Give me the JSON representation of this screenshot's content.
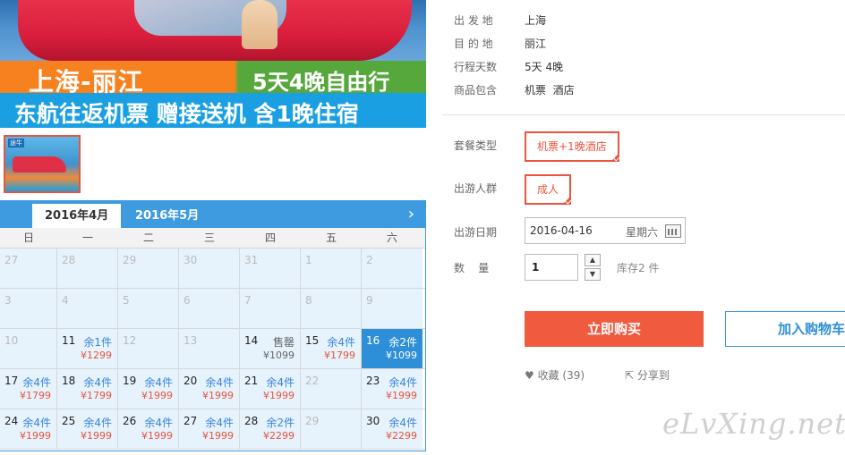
{
  "banner": {
    "title_route": "上海-丽江",
    "title_days": "5天4晚自由行",
    "subtitle": "东航往返机票 赠接送机 含1晚住宿"
  },
  "thumbnail": {
    "tag": "途牛"
  },
  "calendar": {
    "tabs": [
      {
        "label": "2016年4月",
        "active": true
      },
      {
        "label": "2016年5月",
        "active": false
      }
    ],
    "next_arrow": "›",
    "weekdays": [
      "日",
      "一",
      "二",
      "三",
      "四",
      "五",
      "六"
    ],
    "weeks": [
      [
        {
          "d": "27",
          "off": true
        },
        {
          "d": "28",
          "off": true
        },
        {
          "d": "29",
          "off": true
        },
        {
          "d": "30",
          "off": true
        },
        {
          "d": "31",
          "off": true
        },
        {
          "d": "1",
          "off": true
        },
        {
          "d": "2",
          "off": true
        }
      ],
      [
        {
          "d": "3",
          "off": true
        },
        {
          "d": "4",
          "off": true
        },
        {
          "d": "5",
          "off": true
        },
        {
          "d": "6",
          "off": true
        },
        {
          "d": "7",
          "off": true
        },
        {
          "d": "8",
          "off": true
        },
        {
          "d": "9",
          "off": true
        }
      ],
      [
        {
          "d": "10",
          "off": true
        },
        {
          "d": "11",
          "stock": "余1件",
          "price": "¥1299"
        },
        {
          "d": "12",
          "off": true
        },
        {
          "d": "13",
          "off": true
        },
        {
          "d": "14",
          "stock": "售罄",
          "price": "¥1099",
          "sold": true
        },
        {
          "d": "15",
          "stock": "余4件",
          "price": "¥1799"
        },
        {
          "d": "16",
          "stock": "余2件",
          "price": "¥1099",
          "selected": true
        }
      ],
      [
        {
          "d": "17",
          "stock": "余4件",
          "price": "¥1799"
        },
        {
          "d": "18",
          "stock": "余4件",
          "price": "¥1799"
        },
        {
          "d": "19",
          "stock": "余4件",
          "price": "¥1999"
        },
        {
          "d": "20",
          "stock": "余4件",
          "price": "¥1999"
        },
        {
          "d": "21",
          "stock": "余4件",
          "price": "¥1999"
        },
        {
          "d": "22",
          "off": true
        },
        {
          "d": "23",
          "stock": "余4件",
          "price": "¥1999"
        }
      ],
      [
        {
          "d": "24",
          "stock": "余4件",
          "price": "¥1999"
        },
        {
          "d": "25",
          "stock": "余4件",
          "price": "¥1999"
        },
        {
          "d": "26",
          "stock": "余4件",
          "price": "¥1999"
        },
        {
          "d": "27",
          "stock": "余4件",
          "price": "¥1999"
        },
        {
          "d": "28",
          "stock": "余2件",
          "price": "¥2299"
        },
        {
          "d": "29",
          "off": true
        },
        {
          "d": "30",
          "stock": "余4件",
          "price": "¥2299"
        }
      ]
    ]
  },
  "info": {
    "departure_label": "出 发 地",
    "departure_value": "上海",
    "destination_label": "目 的 地",
    "destination_value": "丽江",
    "days_label": "行程天数",
    "days_value": "5天 4晚",
    "includes_label": "商品包含",
    "includes_value": "机票  酒店"
  },
  "options": {
    "package_label": "套餐类型",
    "package_value": "机票+1晚酒店",
    "traveler_label": "出游人群",
    "traveler_value": "成人",
    "date_label": "出游日期",
    "date_value": "2016-04-16",
    "date_weekday": "星期六",
    "qty_label": "数    量",
    "qty_value": "1",
    "qty_up": "▲",
    "qty_down": "▼",
    "stock_note": "库存2 件"
  },
  "actions": {
    "buy": "立即购买",
    "cart": "加入购物车",
    "favorite": "收藏 (39)",
    "share": "分享到"
  },
  "watermark": "eLvXing.net",
  "colors": {
    "accent": "#f05a3f",
    "calendar_blue": "#3f9be0",
    "stock_blue": "#3a86d8"
  }
}
